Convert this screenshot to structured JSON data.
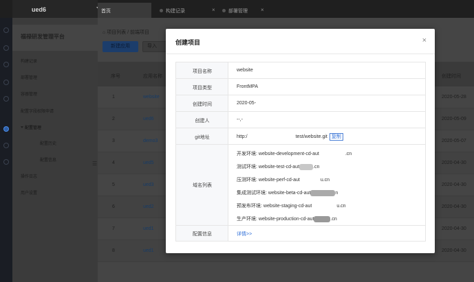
{
  "header": {
    "project": "ued6",
    "tabs": [
      {
        "label": "首页"
      },
      {
        "label": "构建记录",
        "close": "×"
      },
      {
        "label": "部署管理",
        "close": "×"
      }
    ]
  },
  "sidebar": {
    "brand": "福禄研发管理平台",
    "items": [
      {
        "label": "构建记录"
      },
      {
        "label": "部署管理"
      },
      {
        "label": "容器管理"
      },
      {
        "label": "配置字段权限申请"
      },
      {
        "label": "配置管理"
      },
      {
        "label": "配置历史"
      },
      {
        "label": "配置信息"
      },
      {
        "label": "操作日志"
      },
      {
        "label": "用户设置"
      }
    ]
  },
  "main": {
    "breadcrumb": "项目列表 / 前端项目",
    "new_button": "新建应用",
    "import_button": "导入",
    "columns": [
      "序号",
      "应用名称",
      "创建时间"
    ],
    "rows": [
      {
        "index": "1",
        "name": "website",
        "created": "2020-05-28"
      },
      {
        "index": "2",
        "name": "ued6",
        "created": "2020-05-09"
      },
      {
        "index": "3",
        "name": "demo3",
        "created": "2020-05-07"
      },
      {
        "index": "4",
        "name": "ued5",
        "created": "2020-04-30"
      },
      {
        "index": "5",
        "name": "ued3",
        "created": "2020-04-30"
      },
      {
        "index": "6",
        "name": "ued2",
        "created": "2020-04-30"
      },
      {
        "index": "7",
        "name": "ued1",
        "created": "2020-04-30"
      },
      {
        "index": "8",
        "name": "ued1",
        "created": "2020-04-30"
      }
    ]
  },
  "modal": {
    "title": "创建项目",
    "close": "×",
    "fields": {
      "name_label": "项目名称",
      "name_value": "website",
      "type_label": "项目类型",
      "type_value": "FrontMPA",
      "time_label": "创建时间",
      "time_value": "2020-05-",
      "creator_label": "创建人",
      "creator_value": "--,-",
      "git_label": "git地址",
      "git_value_start": "http:/",
      "git_value_end": "test/website.git",
      "copy_label": "复制",
      "domains_label": "域名列表",
      "domains": [
        {
          "prefix": "开发环境: website-development-cd-aut",
          "suffix": ".cn"
        },
        {
          "prefix": "测试环境: website-test-cd-aut",
          "suffix": ".cn"
        },
        {
          "prefix": "压测环境: website-perf-cd-aut",
          "suffix": "u.cn"
        },
        {
          "prefix": "集成测试环境: website-beta-cd-aut",
          "suffix": "n"
        },
        {
          "prefix": "预发布环境: website-staging-cd-aut",
          "suffix": "u.cn"
        },
        {
          "prefix": "生产环境: website-production-cd-aut",
          "suffix": ".cn"
        }
      ],
      "config_label": "配置信息",
      "config_value": "详情>>"
    }
  }
}
